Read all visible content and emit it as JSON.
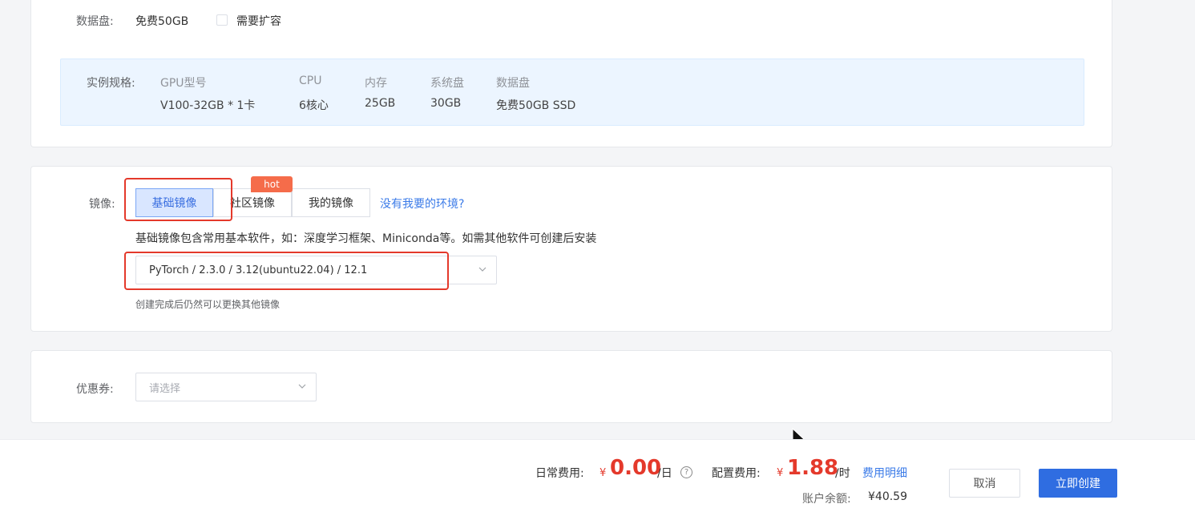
{
  "disk": {
    "label": "数据盘:",
    "value": "免费50GB",
    "expand_label": "需要扩容"
  },
  "spec": {
    "label": "实例规格:",
    "columns": [
      {
        "head": "GPU型号",
        "value": "V100-32GB * 1卡"
      },
      {
        "head": "CPU",
        "value": "6核心"
      },
      {
        "head": "内存",
        "value": "25GB"
      },
      {
        "head": "系统盘",
        "value": "30GB"
      },
      {
        "head": "数据盘",
        "value": "免费50GB SSD"
      }
    ]
  },
  "image": {
    "label": "镜像:",
    "tabs": [
      {
        "label": "基础镜像",
        "active": true
      },
      {
        "label": "社区镜像",
        "active": false
      },
      {
        "label": "我的镜像",
        "active": false
      }
    ],
    "hot_badge": "hot",
    "missing_env_link": "没有我要的环境?",
    "description": "基础镜像包含常用基本软件，如：深度学习框架、Miniconda等。如需其他软件可创建后安装",
    "selected": "PyTorch / 2.3.0 / 3.12(ubuntu22.04) / 12.1",
    "hint": "创建完成后仍然可以更换其他镜像"
  },
  "coupon": {
    "label": "优惠券:",
    "placeholder": "请选择"
  },
  "footer": {
    "daily_label": "日常费用:",
    "currency": "¥",
    "daily_value": "0.00",
    "daily_unit": "/日",
    "config_label": "配置费用:",
    "config_value": "1.88",
    "config_unit": "/时",
    "cost_detail_link": "费用明细",
    "balance_label": "账户余额:",
    "balance_value": "¥40.59",
    "cancel_label": "取消",
    "create_label": "立即创建"
  },
  "colors": {
    "accent": "#2f6de1",
    "highlight": "#e4392b",
    "spec_bg": "#ecf5ff",
    "hot": "#f56c4a"
  }
}
